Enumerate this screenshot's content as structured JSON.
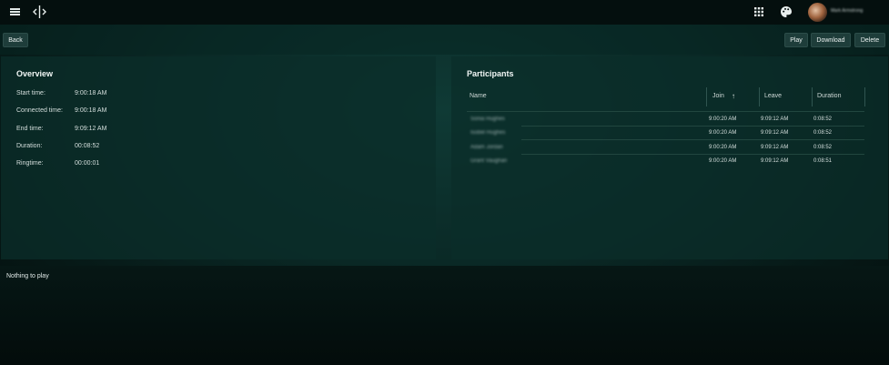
{
  "topbar": {
    "menu_icon": "hamburger-icon",
    "logo_icon": "logo-icon",
    "apps_icon": "grid-icon",
    "theme_icon": "palette-icon",
    "user_name": "Mark Armstrong"
  },
  "toolbar": {
    "back_label": "Back",
    "play_label": "Play",
    "download_label": "Download",
    "delete_label": "Delete"
  },
  "overview": {
    "title": "Overview",
    "rows": [
      {
        "label": "Start time:",
        "value": "9:00:18 AM"
      },
      {
        "label": "Connected time:",
        "value": "9:00:18 AM"
      },
      {
        "label": "End time:",
        "value": "9:09:12 AM"
      },
      {
        "label": "Duration:",
        "value": "00:08:52"
      },
      {
        "label": "Ringtime:",
        "value": "00:00:01"
      }
    ]
  },
  "participants": {
    "title": "Participants",
    "columns": {
      "name": "Name",
      "join": "Join",
      "leave": "Leave",
      "duration": "Duration"
    },
    "sort_icon": "arrow-up-icon",
    "rows": [
      {
        "name": "Sonia Hughes",
        "join": "9:00:20 AM",
        "leave": "9:09:12 AM",
        "duration": "0:08:52"
      },
      {
        "name": "Isobel Hughes",
        "join": "9:00:20 AM",
        "leave": "9:09:12 AM",
        "duration": "0:08:52"
      },
      {
        "name": "Adam Jordan",
        "join": "9:00:20 AM",
        "leave": "9:09:12 AM",
        "duration": "0:08:52"
      },
      {
        "name": "Grant Vaughan",
        "join": "9:00:20 AM",
        "leave": "9:09:12 AM",
        "duration": "0:08:51"
      }
    ]
  },
  "player": {
    "message": "Nothing to play"
  }
}
